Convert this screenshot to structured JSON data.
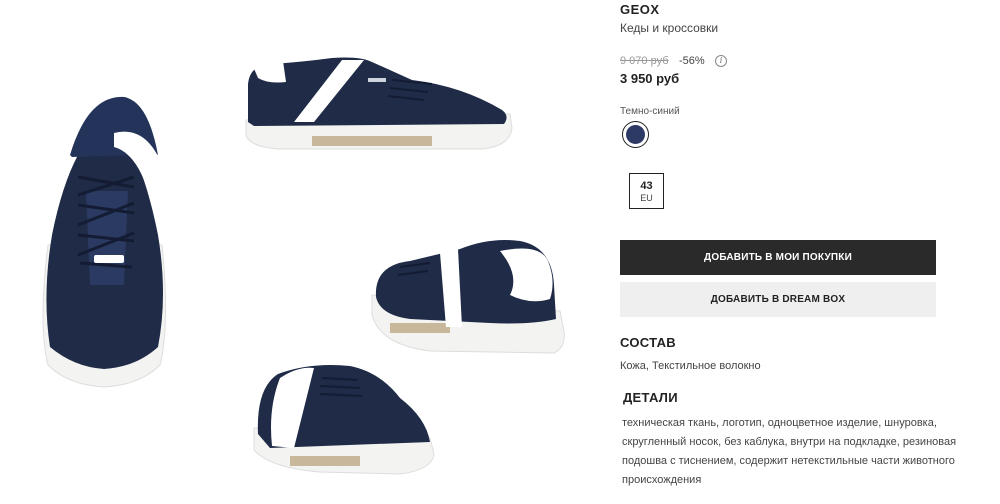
{
  "product": {
    "brand": "GEOX",
    "category": "Кеды и кроссовки",
    "old_price": "9 070 руб",
    "discount": "-56%",
    "info_glyph": "i",
    "price": "3 950 руб"
  },
  "color": {
    "name": "Темно-синий",
    "swatch_hex": "#2e3a66"
  },
  "size": {
    "value": "43",
    "unit": "EU"
  },
  "actions": {
    "add_to_cart": "ДОБАВИТЬ В МОИ ПОКУПКИ",
    "add_to_dreambox": "ДОБАВИТЬ В DREAM BOX"
  },
  "composition": {
    "title": "СОСТАВ",
    "text": "Кожа, Текстильное волокно"
  },
  "details": {
    "title": "ДЕТАЛИ",
    "text": "техническая ткань, логотип, одноцветное изделие, шнуровка, скругленный носок, без каблука, внутри на подкладке, резиновая подошва с тиснением, содержит нетекстильные части животного происхождения"
  },
  "gallery": {
    "images": [
      "front-view",
      "side-view",
      "back-view",
      "three-quarter-view"
    ],
    "shoe_color": "#1f2b47",
    "sole_color": "#f3f3f1"
  }
}
